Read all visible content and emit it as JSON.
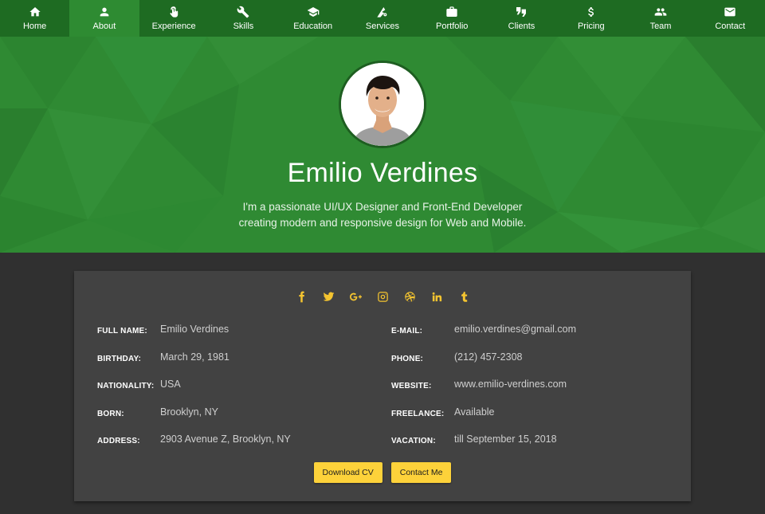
{
  "nav": {
    "items": [
      {
        "label": "Home",
        "icon": "home-icon"
      },
      {
        "label": "About",
        "icon": "user-icon",
        "active": true
      },
      {
        "label": "Experience",
        "icon": "pointer-hand-icon"
      },
      {
        "label": "Skills",
        "icon": "wrench-icon"
      },
      {
        "label": "Education",
        "icon": "graduation-cap-icon"
      },
      {
        "label": "Services",
        "icon": "services-icon"
      },
      {
        "label": "Portfolio",
        "icon": "briefcase-icon"
      },
      {
        "label": "Clients",
        "icon": "quote-icon"
      },
      {
        "label": "Pricing",
        "icon": "dollar-icon"
      },
      {
        "label": "Team",
        "icon": "team-icon"
      },
      {
        "label": "Contact",
        "icon": "mail-icon"
      }
    ]
  },
  "profile": {
    "name": "Emilio Verdines",
    "bio": "I'm a passionate UI/UX Designer and Front-End Developer creating modern and responsive design for Web and Mobile."
  },
  "socials": [
    "facebook-icon",
    "twitter-icon",
    "google-plus-icon",
    "instagram-icon",
    "dribbble-icon",
    "linkedin-icon",
    "tumblr-icon"
  ],
  "info": {
    "left": [
      {
        "key": "FULL NAME:",
        "value": "Emilio Verdines"
      },
      {
        "key": "BIRTHDAY:",
        "value": "March 29, 1981"
      },
      {
        "key": "NATIONALITY:",
        "value": "USA"
      },
      {
        "key": "BORN:",
        "value": "Brooklyn, NY"
      },
      {
        "key": "ADDRESS:",
        "value": "2903 Avenue Z, Brooklyn, NY"
      }
    ],
    "right": [
      {
        "key": "E-MAIL:",
        "value": "emilio.verdines@gmail.com"
      },
      {
        "key": "PHONE:",
        "value": "(212) 457-2308"
      },
      {
        "key": "WEBSITE:",
        "value": "www.emilio-verdines.com"
      },
      {
        "key": "FREELANCE:",
        "value": "Available"
      },
      {
        "key": "VACATION:",
        "value": "till September 15, 2018"
      }
    ]
  },
  "buttons": {
    "download_cv": "Download CV",
    "contact_me": "Contact Me"
  },
  "colors": {
    "nav_bg": "#1e6b22",
    "nav_active": "#2e8b32",
    "hero_bg": "#2f8a33",
    "page_bg": "#303030",
    "card_bg": "#424242",
    "accent": "#fdd23a"
  }
}
